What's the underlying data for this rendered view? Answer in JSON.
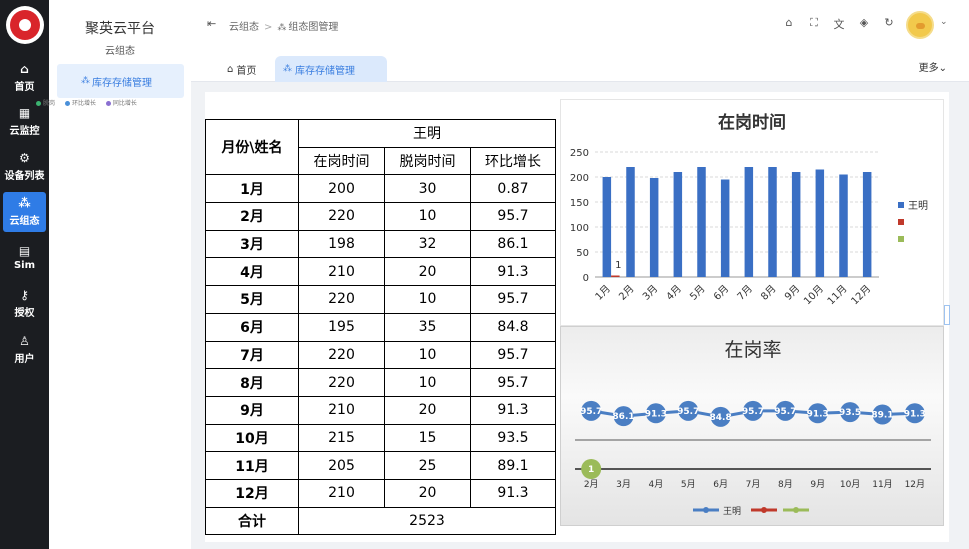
{
  "rail": {
    "items": [
      {
        "label": "首页",
        "icon": "home-icon",
        "glyph": "⌂"
      },
      {
        "label": "云监控",
        "icon": "monitor-icon",
        "glyph": "▦"
      },
      {
        "label": "设备列表",
        "icon": "gear-icon",
        "glyph": "⚙"
      },
      {
        "label": "云组态",
        "icon": "nodes-icon",
        "glyph": "⁂"
      },
      {
        "label": "Sim",
        "icon": "sim-icon",
        "glyph": "▤"
      },
      {
        "label": "授权",
        "icon": "key-icon",
        "glyph": "⚷"
      },
      {
        "label": "用户",
        "icon": "user-icon",
        "glyph": "♙"
      }
    ]
  },
  "sidebar": {
    "title": "聚英云平台",
    "subtitle": "云组态",
    "menu_label": "库存存储管理"
  },
  "header": {
    "breadcrumb": [
      "云组态",
      "组态图管理"
    ],
    "icons": [
      "fold-icon",
      "dashboard-icon",
      "fullscreen-icon",
      "translate-icon",
      "theme-icon",
      "refresh-icon"
    ]
  },
  "tabs": {
    "items": [
      "首页",
      "库存存储管理"
    ],
    "more": "更多"
  },
  "legend": [
    "脱岗",
    "环比增长",
    "同比增长"
  ],
  "table": {
    "corner": "月份\\姓名",
    "person": "王明",
    "columns": [
      "在岗时间",
      "脱岗时间",
      "环比增长"
    ],
    "rows": [
      {
        "month": "1月",
        "on": "200",
        "off": "30",
        "ratio": "0.87"
      },
      {
        "month": "2月",
        "on": "220",
        "off": "10",
        "ratio": "95.7"
      },
      {
        "month": "3月",
        "on": "198",
        "off": "32",
        "ratio": "86.1"
      },
      {
        "month": "4月",
        "on": "210",
        "off": "20",
        "ratio": "91.3"
      },
      {
        "month": "5月",
        "on": "220",
        "off": "10",
        "ratio": "95.7"
      },
      {
        "month": "6月",
        "on": "195",
        "off": "35",
        "ratio": "84.8"
      },
      {
        "month": "7月",
        "on": "220",
        "off": "10",
        "ratio": "95.7"
      },
      {
        "month": "8月",
        "on": "220",
        "off": "10",
        "ratio": "95.7"
      },
      {
        "month": "9月",
        "on": "210",
        "off": "20",
        "ratio": "91.3"
      },
      {
        "month": "10月",
        "on": "215",
        "off": "15",
        "ratio": "93.5"
      },
      {
        "month": "11月",
        "on": "205",
        "off": "25",
        "ratio": "89.1"
      },
      {
        "month": "12月",
        "on": "210",
        "off": "20",
        "ratio": "91.3"
      }
    ],
    "total_label": "合计",
    "total_value": "2523"
  },
  "colors": {
    "accent": "#2f7ce6",
    "bar": "#3a6fc4",
    "line": "#4a7ec3",
    "red": "#c0392b",
    "green": "#9bbb59"
  },
  "chart_data": [
    {
      "type": "bar",
      "title": "在岗时间",
      "categories": [
        "1月",
        "2月",
        "3月",
        "4月",
        "5月",
        "6月",
        "7月",
        "8月",
        "9月",
        "10月",
        "11月",
        "12月"
      ],
      "series": [
        {
          "name": "王明",
          "values": [
            200,
            220,
            198,
            210,
            220,
            195,
            220,
            220,
            210,
            215,
            205,
            210
          ]
        },
        {
          "values": [
            1
          ]
        },
        {
          "values": []
        }
      ],
      "ylim": [
        0,
        250
      ],
      "yticks": [
        0,
        50,
        100,
        150,
        200,
        250
      ],
      "annotations": [
        "1"
      ],
      "grid": true,
      "legend": "right"
    },
    {
      "type": "line",
      "title": "在岗率",
      "categories": [
        "2月",
        "3月",
        "4月",
        "5月",
        "6月",
        "7月",
        "8月",
        "9月",
        "10月",
        "11月",
        "12月"
      ],
      "series": [
        {
          "name": "王明",
          "values": [
            95.7,
            86.1,
            91.3,
            95.7,
            84.8,
            95.7,
            95.7,
            91.3,
            93.5,
            89.1,
            91.3
          ]
        },
        {
          "values": []
        },
        {
          "values": [
            1
          ]
        }
      ],
      "grid": true,
      "legend": "bottom"
    }
  ]
}
